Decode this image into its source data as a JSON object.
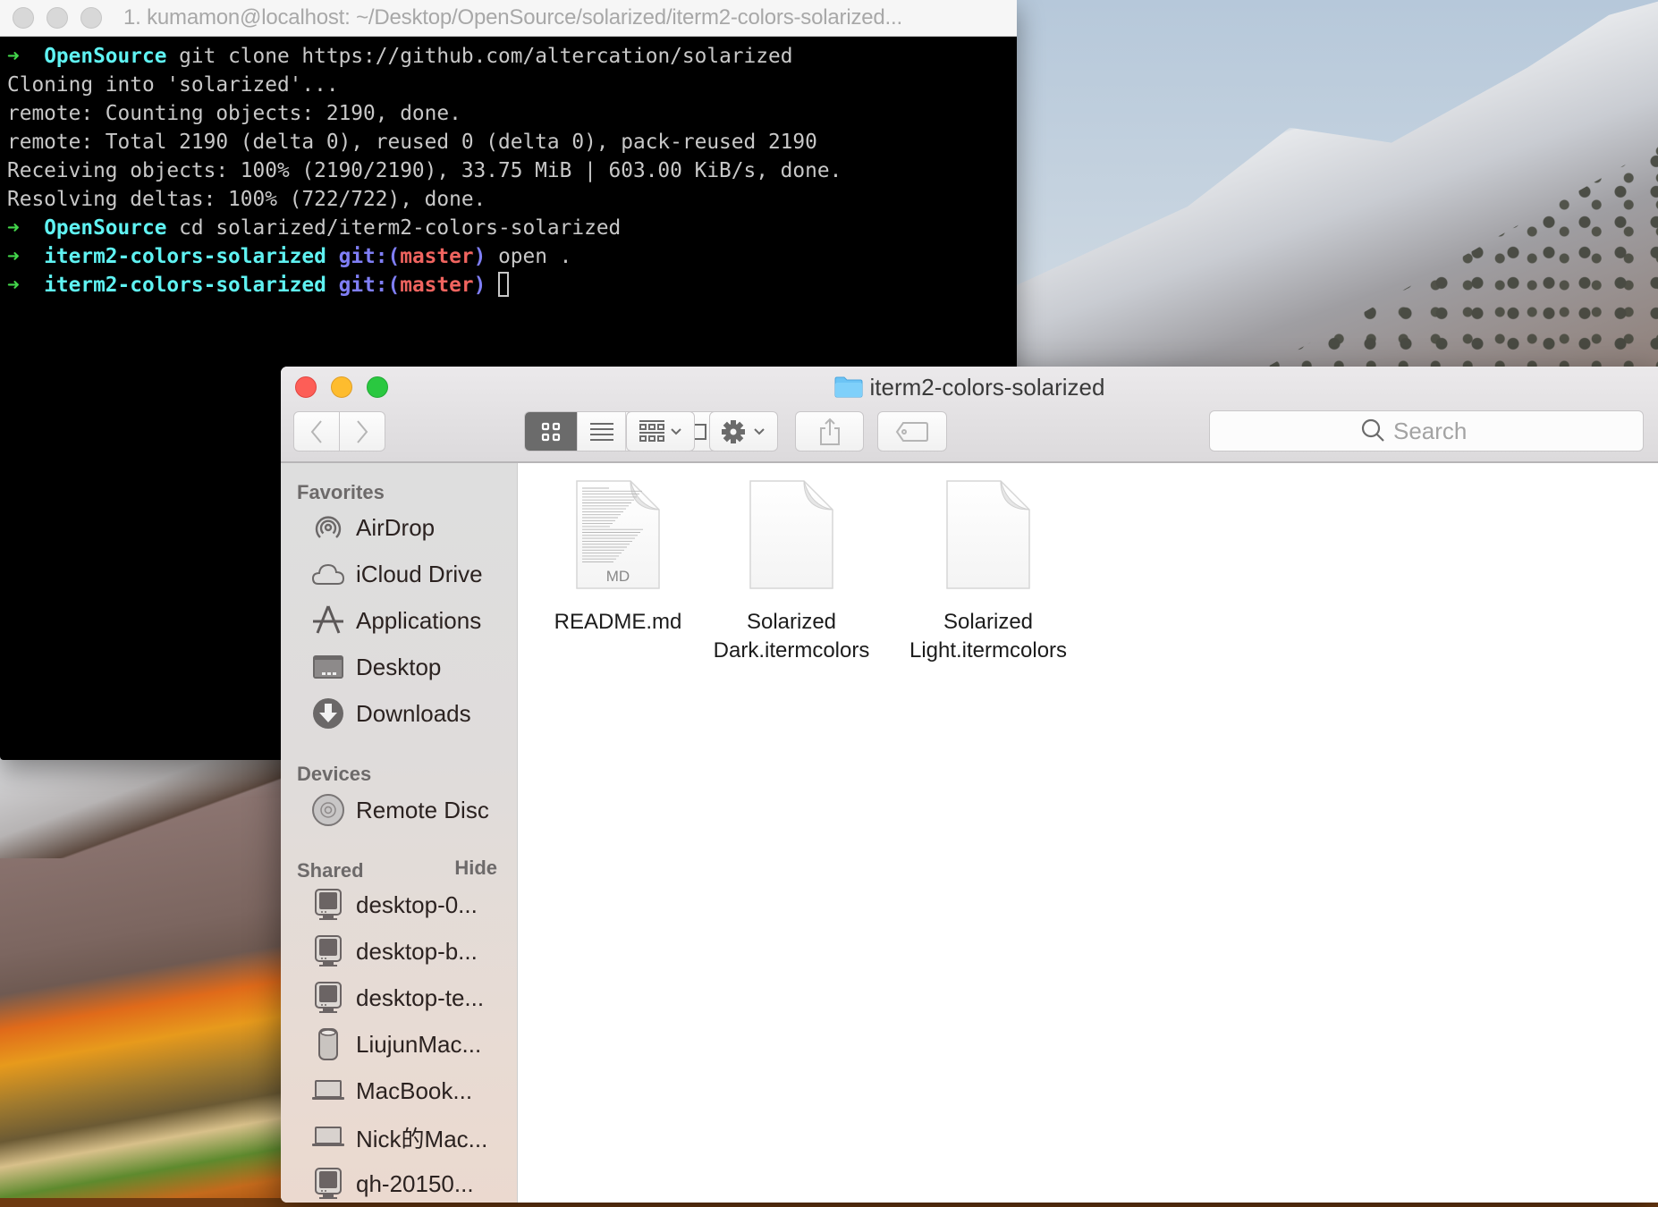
{
  "terminal": {
    "title": "1. kumamon@localhost: ~/Desktop/OpenSource/solarized/iterm2-colors-solarized...",
    "lines": [
      {
        "type": "prompt",
        "arrow": "➜",
        "dir": "OpenSource",
        "cmd": "git clone https://github.com/altercation/solarized"
      },
      {
        "type": "output",
        "text": "Cloning into 'solarized'..."
      },
      {
        "type": "output",
        "text": "remote: Counting objects: 2190, done."
      },
      {
        "type": "output",
        "text": "remote: Total 2190 (delta 0), reused 0 (delta 0), pack-reused 2190"
      },
      {
        "type": "output",
        "text": "Receiving objects: 100% (2190/2190), 33.75 MiB | 603.00 KiB/s, done."
      },
      {
        "type": "output",
        "text": "Resolving deltas: 100% (722/722), done."
      },
      {
        "type": "prompt",
        "arrow": "➜",
        "dir": "OpenSource",
        "cmd": "cd solarized/iterm2-colors-solarized"
      },
      {
        "type": "git_prompt",
        "arrow": "➜",
        "dir": "iterm2-colors-solarized",
        "git": "git:(",
        "branch": "master",
        "close": ")",
        "cmd": "open ."
      },
      {
        "type": "git_prompt",
        "arrow": "➜",
        "dir": "iterm2-colors-solarized",
        "git": "git:(",
        "branch": "master",
        "close": ")",
        "cmd": ""
      }
    ],
    "colors": {
      "arrow": "#43d64b",
      "dir": "#5ff2f2",
      "git": "#7f7ef5",
      "branch": "#f0645f",
      "text": "#c8c8c8"
    }
  },
  "finder": {
    "title": "iterm2-colors-solarized",
    "toolbar": {
      "back": "back",
      "forward": "forward",
      "views": [
        "icon-view",
        "list-view",
        "column-view",
        "cover-flow-view"
      ],
      "active_view": "icon-view",
      "arrange": "arrange-menu",
      "action": "action-menu",
      "share": "share",
      "tags": "edit-tags",
      "search_placeholder": "Search"
    },
    "sidebar": {
      "favorites_label": "Favorites",
      "favorites": [
        {
          "label": "AirDrop",
          "icon": "airdrop-icon"
        },
        {
          "label": "iCloud Drive",
          "icon": "cloud-icon"
        },
        {
          "label": "Applications",
          "icon": "applications-icon"
        },
        {
          "label": "Desktop",
          "icon": "desktop-icon"
        },
        {
          "label": "Downloads",
          "icon": "downloads-icon"
        }
      ],
      "devices_label": "Devices",
      "devices": [
        {
          "label": "Remote Disc",
          "icon": "disc-icon"
        }
      ],
      "shared_label": "Shared",
      "shared_hide": "Hide",
      "shared": [
        {
          "label": "desktop-0...",
          "icon": "monitor-icon"
        },
        {
          "label": "desktop-b...",
          "icon": "monitor-icon"
        },
        {
          "label": "desktop-te...",
          "icon": "monitor-icon"
        },
        {
          "label": "LiujunMac...",
          "icon": "mac-pro-icon"
        },
        {
          "label": "MacBook...",
          "icon": "laptop-icon"
        },
        {
          "label": "Nick的Mac...",
          "icon": "laptop-icon"
        },
        {
          "label": "qh-20150...",
          "icon": "monitor-icon"
        }
      ]
    },
    "files": [
      {
        "name_lines": [
          "README.md"
        ],
        "badge": "MD",
        "kind": "markdown"
      },
      {
        "name_lines": [
          "Solarized",
          "Dark.itermcolors"
        ],
        "badge": "",
        "kind": "generic"
      },
      {
        "name_lines": [
          "Solarized",
          "Light.itermcolors"
        ],
        "badge": "",
        "kind": "generic"
      }
    ]
  }
}
